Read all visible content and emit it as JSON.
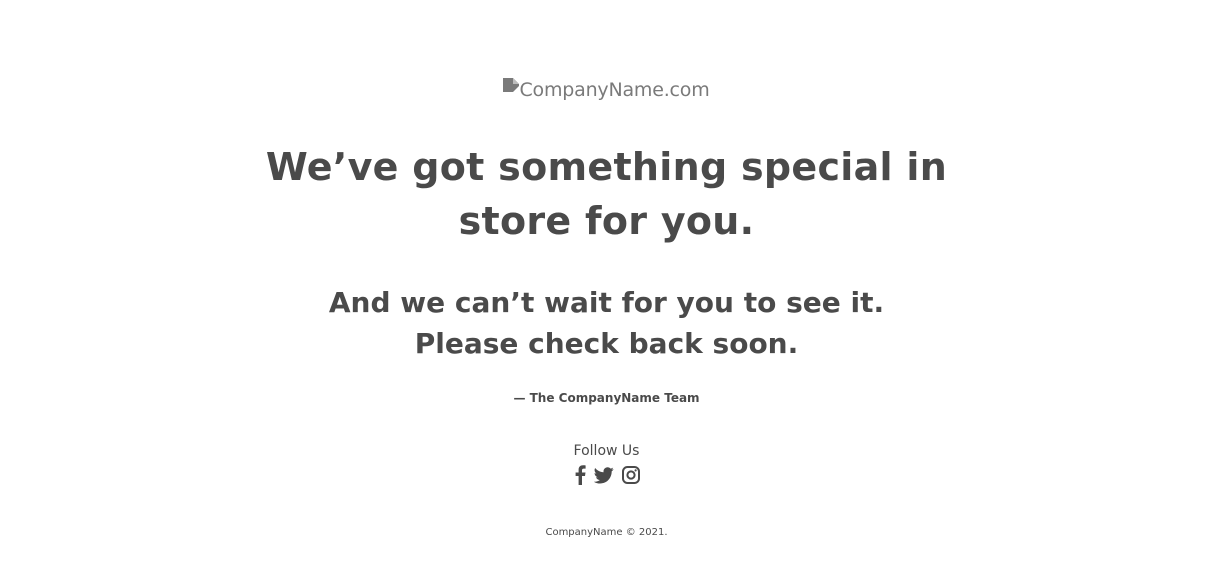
{
  "logo": {
    "alt_text": "CompanyName.com",
    "icon": "broken-image-icon"
  },
  "headline": {
    "line1": "We’ve got something special in",
    "line2": "store for you."
  },
  "subheadline": {
    "line1": "And we can’t wait for you to see it.",
    "line2": "Please check back soon."
  },
  "signature": "— The CompanyName Team",
  "social": {
    "heading": "Follow Us",
    "links": [
      {
        "icon": "facebook-icon"
      },
      {
        "icon": "twitter-icon"
      },
      {
        "icon": "instagram-icon"
      }
    ]
  },
  "footer": {
    "copyright": "CompanyName © 2021."
  },
  "colors": {
    "text": "#4a4a4a",
    "logo_text": "#7a7a7a",
    "background": "#ffffff"
  }
}
